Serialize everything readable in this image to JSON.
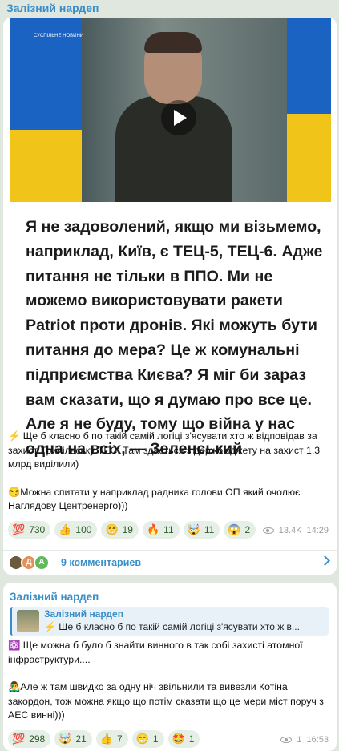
{
  "channel_name": "Залізний нардеп",
  "post1": {
    "video": {
      "logo_text": "СУСПІЛЬНЕ НОВИНИ"
    },
    "quote": "Я не задоволений, якщо ми візьмемо, наприклад, Київ, є ТЕЦ-5, ТЕЦ-6. Адже питання не тільки в ППО. Ми не можемо використовувати ракети Patriot проти дронів. Які можуть бути питання до мера? Це ж комунальні підприємства Києва? Я міг би зараз вам сказати, що я думаю про все це. Але я не буду, тому що війна у нас одна на всіх, — Зеленський",
    "caption_1": "⚡ Ще б класно б по такій самій логіці з'ясувати хто ж відповідав за захист Трипільську ТЕС. Там здається з держбюджету на захист 1,3 млрд виділили)",
    "caption_2": "😏Можна спитати у наприклад радника голови ОП який очолює Наглядову Центренерго)))",
    "reactions": [
      {
        "emoji": "💯",
        "count": "730"
      },
      {
        "emoji": "👍",
        "count": "100"
      },
      {
        "emoji": "😁",
        "count": "19"
      },
      {
        "emoji": "🔥",
        "count": "11"
      },
      {
        "emoji": "🤯",
        "count": "11"
      },
      {
        "emoji": "😱",
        "count": "2"
      }
    ],
    "views": "13.4K",
    "time": "14:29",
    "comment_avatars": [
      "Д",
      "А"
    ],
    "comments_label": "9 комментариев"
  },
  "post2": {
    "reply_title": "Залізний нардеп",
    "reply_text": "⚡ Ще б класно б по такій самій логіці з'ясувати хто ж в...",
    "text_1": "⚛️ Ще можна б було б знайти винного в так собі захисті атомної інфраструктури....",
    "text_2": "👨‍🎤Але ж там швидко за одну ніч звільнили та вивезли Котіна закордон, тож можна якщо що потім сказати що це мери міст поруч з АЕС винні)))",
    "reactions": [
      {
        "emoji": "💯",
        "count": "298"
      },
      {
        "emoji": "🤯",
        "count": "21"
      },
      {
        "emoji": "👍",
        "count": "7"
      },
      {
        "emoji": "😁",
        "count": "1"
      },
      {
        "emoji": "🤩",
        "count": "1"
      }
    ],
    "views": "1",
    "time": "16:53"
  },
  "colors": {
    "accent": "#3a8ec8",
    "background": "#dfe7df",
    "reaction_bg": "#e6efe6"
  }
}
